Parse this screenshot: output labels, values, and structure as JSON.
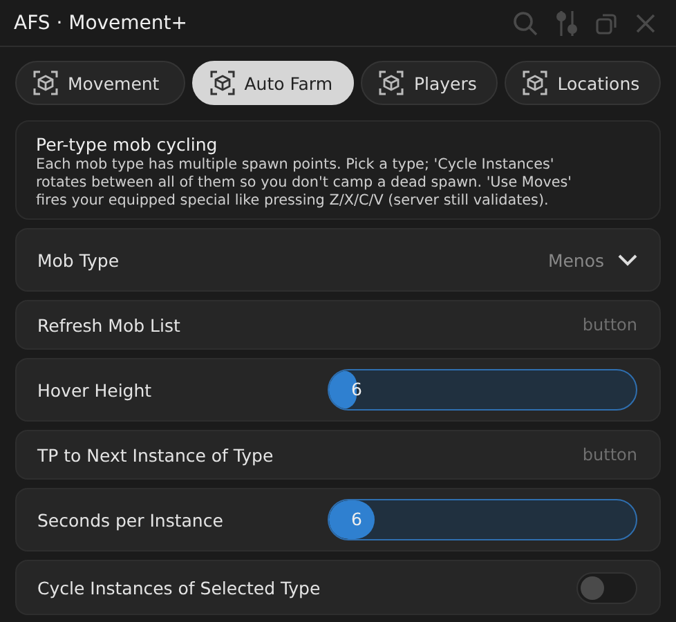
{
  "window": {
    "title": "AFS · Movement+"
  },
  "tabs": [
    {
      "label": "Movement",
      "selected": false
    },
    {
      "label": "Auto Farm",
      "selected": true
    },
    {
      "label": "Players",
      "selected": false
    },
    {
      "label": "Locations",
      "selected": false
    }
  ],
  "info": {
    "title": "Per-type mob cycling",
    "text": "Each mob type has multiple spawn points. Pick a type; 'Cycle Instances' rotates between all of them so you don't camp a dead spawn. 'Use Moves' fires your equipped special like pressing Z/X/C/V (server still validates)."
  },
  "rows": [
    {
      "kind": "dropdown",
      "label": "Mob Type",
      "value": "Menos"
    },
    {
      "kind": "button",
      "label": "Refresh Mob List",
      "hint": "button"
    },
    {
      "kind": "slider",
      "label": "Hover Height",
      "value": "6",
      "level": 0.09
    },
    {
      "kind": "button",
      "label": "TP to Next Instance of Type",
      "hint": "button"
    },
    {
      "kind": "slider",
      "label": "Seconds per Instance",
      "value": "6",
      "level": 0.15
    },
    {
      "kind": "toggle",
      "label": "Cycle Instances of Selected Type",
      "on": false
    }
  ]
}
